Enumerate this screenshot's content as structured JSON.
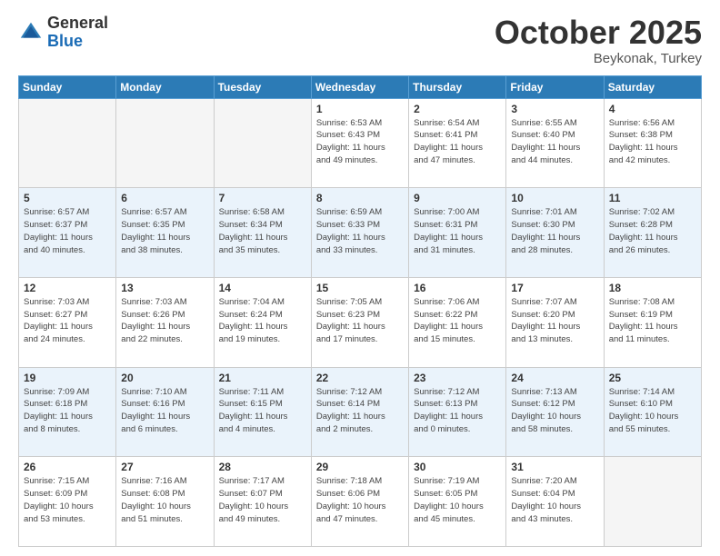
{
  "header": {
    "logo_general": "General",
    "logo_blue": "Blue",
    "month": "October 2025",
    "location": "Beykonak, Turkey"
  },
  "weekdays": [
    "Sunday",
    "Monday",
    "Tuesday",
    "Wednesday",
    "Thursday",
    "Friday",
    "Saturday"
  ],
  "weeks": [
    [
      {
        "day": "",
        "info": ""
      },
      {
        "day": "",
        "info": ""
      },
      {
        "day": "",
        "info": ""
      },
      {
        "day": "1",
        "info": "Sunrise: 6:53 AM\nSunset: 6:43 PM\nDaylight: 11 hours\nand 49 minutes."
      },
      {
        "day": "2",
        "info": "Sunrise: 6:54 AM\nSunset: 6:41 PM\nDaylight: 11 hours\nand 47 minutes."
      },
      {
        "day": "3",
        "info": "Sunrise: 6:55 AM\nSunset: 6:40 PM\nDaylight: 11 hours\nand 44 minutes."
      },
      {
        "day": "4",
        "info": "Sunrise: 6:56 AM\nSunset: 6:38 PM\nDaylight: 11 hours\nand 42 minutes."
      }
    ],
    [
      {
        "day": "5",
        "info": "Sunrise: 6:57 AM\nSunset: 6:37 PM\nDaylight: 11 hours\nand 40 minutes."
      },
      {
        "day": "6",
        "info": "Sunrise: 6:57 AM\nSunset: 6:35 PM\nDaylight: 11 hours\nand 38 minutes."
      },
      {
        "day": "7",
        "info": "Sunrise: 6:58 AM\nSunset: 6:34 PM\nDaylight: 11 hours\nand 35 minutes."
      },
      {
        "day": "8",
        "info": "Sunrise: 6:59 AM\nSunset: 6:33 PM\nDaylight: 11 hours\nand 33 minutes."
      },
      {
        "day": "9",
        "info": "Sunrise: 7:00 AM\nSunset: 6:31 PM\nDaylight: 11 hours\nand 31 minutes."
      },
      {
        "day": "10",
        "info": "Sunrise: 7:01 AM\nSunset: 6:30 PM\nDaylight: 11 hours\nand 28 minutes."
      },
      {
        "day": "11",
        "info": "Sunrise: 7:02 AM\nSunset: 6:28 PM\nDaylight: 11 hours\nand 26 minutes."
      }
    ],
    [
      {
        "day": "12",
        "info": "Sunrise: 7:03 AM\nSunset: 6:27 PM\nDaylight: 11 hours\nand 24 minutes."
      },
      {
        "day": "13",
        "info": "Sunrise: 7:03 AM\nSunset: 6:26 PM\nDaylight: 11 hours\nand 22 minutes."
      },
      {
        "day": "14",
        "info": "Sunrise: 7:04 AM\nSunset: 6:24 PM\nDaylight: 11 hours\nand 19 minutes."
      },
      {
        "day": "15",
        "info": "Sunrise: 7:05 AM\nSunset: 6:23 PM\nDaylight: 11 hours\nand 17 minutes."
      },
      {
        "day": "16",
        "info": "Sunrise: 7:06 AM\nSunset: 6:22 PM\nDaylight: 11 hours\nand 15 minutes."
      },
      {
        "day": "17",
        "info": "Sunrise: 7:07 AM\nSunset: 6:20 PM\nDaylight: 11 hours\nand 13 minutes."
      },
      {
        "day": "18",
        "info": "Sunrise: 7:08 AM\nSunset: 6:19 PM\nDaylight: 11 hours\nand 11 minutes."
      }
    ],
    [
      {
        "day": "19",
        "info": "Sunrise: 7:09 AM\nSunset: 6:18 PM\nDaylight: 11 hours\nand 8 minutes."
      },
      {
        "day": "20",
        "info": "Sunrise: 7:10 AM\nSunset: 6:16 PM\nDaylight: 11 hours\nand 6 minutes."
      },
      {
        "day": "21",
        "info": "Sunrise: 7:11 AM\nSunset: 6:15 PM\nDaylight: 11 hours\nand 4 minutes."
      },
      {
        "day": "22",
        "info": "Sunrise: 7:12 AM\nSunset: 6:14 PM\nDaylight: 11 hours\nand 2 minutes."
      },
      {
        "day": "23",
        "info": "Sunrise: 7:12 AM\nSunset: 6:13 PM\nDaylight: 11 hours\nand 0 minutes."
      },
      {
        "day": "24",
        "info": "Sunrise: 7:13 AM\nSunset: 6:12 PM\nDaylight: 10 hours\nand 58 minutes."
      },
      {
        "day": "25",
        "info": "Sunrise: 7:14 AM\nSunset: 6:10 PM\nDaylight: 10 hours\nand 55 minutes."
      }
    ],
    [
      {
        "day": "26",
        "info": "Sunrise: 7:15 AM\nSunset: 6:09 PM\nDaylight: 10 hours\nand 53 minutes."
      },
      {
        "day": "27",
        "info": "Sunrise: 7:16 AM\nSunset: 6:08 PM\nDaylight: 10 hours\nand 51 minutes."
      },
      {
        "day": "28",
        "info": "Sunrise: 7:17 AM\nSunset: 6:07 PM\nDaylight: 10 hours\nand 49 minutes."
      },
      {
        "day": "29",
        "info": "Sunrise: 7:18 AM\nSunset: 6:06 PM\nDaylight: 10 hours\nand 47 minutes."
      },
      {
        "day": "30",
        "info": "Sunrise: 7:19 AM\nSunset: 6:05 PM\nDaylight: 10 hours\nand 45 minutes."
      },
      {
        "day": "31",
        "info": "Sunrise: 7:20 AM\nSunset: 6:04 PM\nDaylight: 10 hours\nand 43 minutes."
      },
      {
        "day": "",
        "info": ""
      }
    ]
  ]
}
